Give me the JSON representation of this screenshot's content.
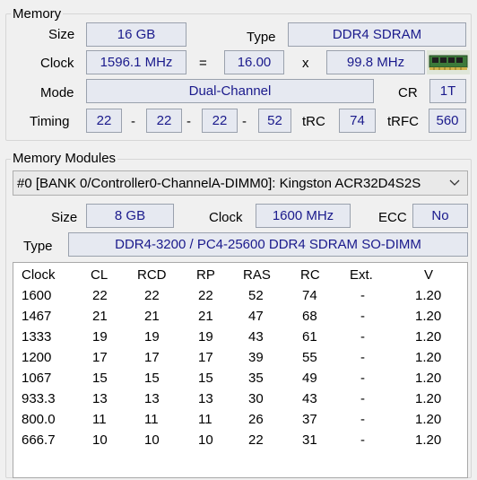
{
  "memory": {
    "group_title": "Memory",
    "size_label": "Size",
    "size_value": "16 GB",
    "type_label": "Type",
    "type_value": "DDR4 SDRAM",
    "clock_label": "Clock",
    "clock_value": "1596.1 MHz",
    "equals": "=",
    "multiplier_value": "16.00",
    "times": "x",
    "bus_value": "99.8 MHz",
    "mode_label": "Mode",
    "mode_value": "Dual-Channel",
    "cr_label": "CR",
    "cr_value": "1T",
    "timing_label": "Timing",
    "timings": [
      "22",
      "22",
      "22",
      "52"
    ],
    "dash": "-",
    "trc_label": "tRC",
    "trc_value": "74",
    "trfc_label": "tRFC",
    "trfc_value": "560"
  },
  "modules": {
    "group_title": "Memory Modules",
    "selected_module": "#0 [BANK 0/Controller0-ChannelA-DIMM0]: Kingston ACR32D4S2S",
    "size_label": "Size",
    "size_value": "8 GB",
    "clock_label": "Clock",
    "clock_value": "1600 MHz",
    "ecc_label": "ECC",
    "ecc_value": "No",
    "type_label": "Type",
    "type_value": "DDR4-3200 / PC4-25600 DDR4 SDRAM SO-DIMM"
  },
  "timing_table": {
    "headers": [
      "Clock",
      "CL",
      "RCD",
      "RP",
      "RAS",
      "RC",
      "Ext.",
      "V"
    ],
    "rows": [
      [
        "1600",
        "22",
        "22",
        "22",
        "52",
        "74",
        "-",
        "1.20"
      ],
      [
        "1467",
        "21",
        "21",
        "21",
        "47",
        "68",
        "-",
        "1.20"
      ],
      [
        "1333",
        "19",
        "19",
        "19",
        "43",
        "61",
        "-",
        "1.20"
      ],
      [
        "1200",
        "17",
        "17",
        "17",
        "39",
        "55",
        "-",
        "1.20"
      ],
      [
        "1067",
        "15",
        "15",
        "15",
        "35",
        "49",
        "-",
        "1.20"
      ],
      [
        "933.3",
        "13",
        "13",
        "13",
        "30",
        "43",
        "-",
        "1.20"
      ],
      [
        "800.0",
        "11",
        "11",
        "11",
        "26",
        "37",
        "-",
        "1.20"
      ],
      [
        "666.7",
        "10",
        "10",
        "10",
        "22",
        "31",
        "-",
        "1.20"
      ]
    ]
  },
  "icons": {
    "ram": "ram-module-icon",
    "dropdown": "chevron-down-icon"
  },
  "colors": {
    "field_background": "#e6e9f1",
    "field_text": "#1a1a8c",
    "window_background": "#f0f0f0"
  }
}
